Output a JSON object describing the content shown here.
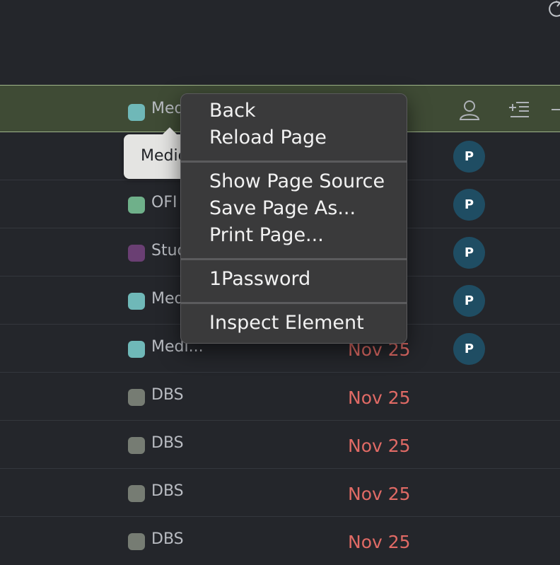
{
  "context_menu": {
    "items": [
      "Back",
      "Reload Page",
      "Show Page Source",
      "Save Page As...",
      "Print Page...",
      "1Password",
      "Inspect Element"
    ]
  },
  "tooltip": {
    "text": "Medic"
  },
  "avatar_initial": "P",
  "rows": [
    {
      "title": "Med",
      "date": "",
      "color": "#6fb8b8",
      "has_avatar": false
    },
    {
      "title": "",
      "date": "",
      "color": "",
      "has_avatar": true
    },
    {
      "title": "OFI",
      "date": "",
      "color": "#6fb08a",
      "has_avatar": true
    },
    {
      "title": "Stud",
      "date": "",
      "color": "#6a3f73",
      "has_avatar": true
    },
    {
      "title": "Med",
      "date": "",
      "color": "#6fb8b8",
      "has_avatar": true
    },
    {
      "title": "Medi...",
      "date": "Nov 25",
      "color": "#6fb8b8",
      "has_avatar": true
    },
    {
      "title": "DBS",
      "date": "Nov 25",
      "color": "#767c73",
      "has_avatar": false
    },
    {
      "title": "DBS",
      "date": "Nov 25",
      "color": "#767c73",
      "has_avatar": false
    },
    {
      "title": "DBS",
      "date": "Nov 25",
      "color": "#767c73",
      "has_avatar": false
    },
    {
      "title": "DBS",
      "date": "Nov 25",
      "color": "#767c73",
      "has_avatar": false
    }
  ],
  "icons": {
    "top_right": "refresh-icon",
    "header": [
      "person-icon",
      "add-list-icon",
      "minus-icon"
    ]
  }
}
